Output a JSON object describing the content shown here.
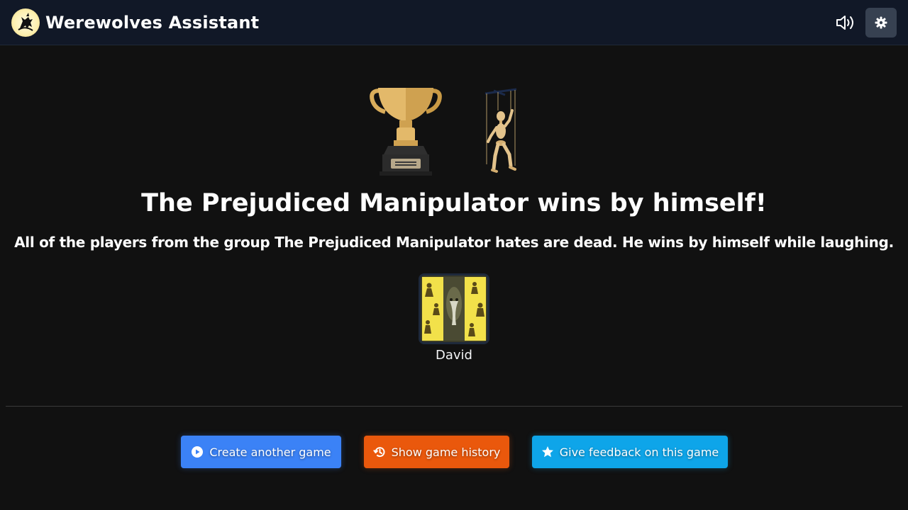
{
  "app": {
    "title": "Werewolves Assistant",
    "logo_icon": "werewolf-logo-icon"
  },
  "header": {
    "sound_icon": "speaker-volume-icon",
    "settings_icon": "gear-icon"
  },
  "result": {
    "images": [
      "trophy-icon",
      "puppet-marionette-icon"
    ],
    "title": "The Prejudiced Manipulator wins by himself!",
    "description": "All of the players from the group The Prejudiced Manipulator hates are dead. He wins by himself while laughing."
  },
  "winners": [
    {
      "name": "David",
      "role_icon": "prejudiced-manipulator-role-card"
    }
  ],
  "actions": {
    "create": {
      "label": "Create another game",
      "icon": "play-circle-icon",
      "color": "#3b82f6"
    },
    "history": {
      "label": "Show game history",
      "icon": "history-icon",
      "color": "#ea580c"
    },
    "feedback": {
      "label": "Give feedback on this game",
      "icon": "star-icon",
      "color": "#0ea5e9"
    }
  },
  "colors": {
    "background": "#111111",
    "header": "#111827"
  }
}
